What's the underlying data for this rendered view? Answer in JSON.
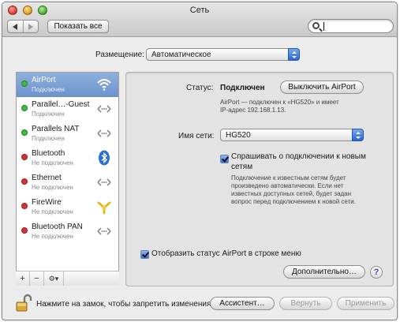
{
  "window": {
    "title": "Сеть"
  },
  "toolbar": {
    "show_all_label": "Показать все",
    "search_value": ""
  },
  "location": {
    "label": "Размещение:",
    "value": "Автоматическое"
  },
  "services": [
    {
      "name": "AirPort",
      "status": "Подключен",
      "dot": "#3dbb3d",
      "icon": "wifi-icon",
      "selected": true
    },
    {
      "name": "Parallel…-Guest",
      "status": "Подключен",
      "dot": "#3dbb3d",
      "icon": "ethernet-icon"
    },
    {
      "name": "Parallels NAT",
      "status": "Подключен",
      "dot": "#3dbb3d",
      "icon": "ethernet-icon"
    },
    {
      "name": "Bluetooth",
      "status": "Не подключен",
      "dot": "#d83030",
      "icon": "bluetooth-icon"
    },
    {
      "name": "Ethernet",
      "status": "Не подключен",
      "dot": "#d83030",
      "icon": "ethernet-icon"
    },
    {
      "name": "FireWire",
      "status": "Не подключен",
      "dot": "#d83030",
      "icon": "firewire-icon"
    },
    {
      "name": "Bluetooth PAN",
      "status": "Не подключен",
      "dot": "#d83030",
      "icon": "ethernet-icon"
    }
  ],
  "sidebar_controls": {
    "add": "+",
    "remove": "−",
    "action": "⚙▾"
  },
  "detail": {
    "status_label": "Статус:",
    "status_value": "Подключен",
    "disconnect_label": "Выключить AirPort",
    "status_desc_1": "AirPort — подключен к «HG520» и имеет",
    "status_desc_2": "IP-адрес 192.168.1.13.",
    "network_label": "Имя сети:",
    "network_value": "HG520",
    "ask_checkbox_label_1": "Спрашивать о подключении к новым",
    "ask_checkbox_label_2": "сетям",
    "ask_note": [
      "Подключение к известным сетям будет",
      "произведено автоматически. Если нет",
      "известных доступных сетей, будет задан",
      "вопрос перед подключением к новой сети."
    ],
    "menu_status_label": "Отобразить статус AirPort в строке меню",
    "advanced_label": "Дополнительно…",
    "help_label": "?"
  },
  "footer": {
    "lock_text": "Нажмите на замок, чтобы запретить изменения.",
    "assistant_label": "Ассистент…",
    "revert_label": "Вернуть",
    "apply_label": "Применить"
  },
  "colors": {
    "selection": "#7a9fd4",
    "accent": "#3a74d6",
    "connected": "#3dbb3d",
    "disconnected": "#d83030"
  }
}
